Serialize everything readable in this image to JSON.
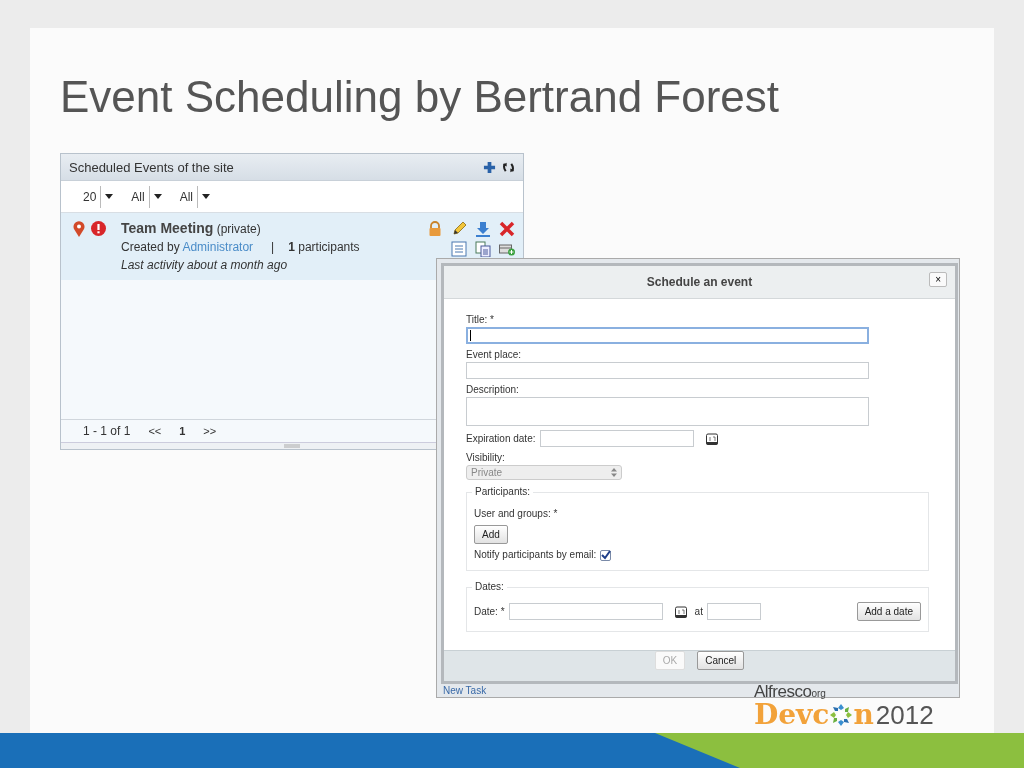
{
  "slide": {
    "title": "Event Scheduling by Bertrand Forest"
  },
  "events_panel": {
    "title": "Scheduled Events of the site",
    "filters": [
      {
        "value": "20"
      },
      {
        "value": "All"
      },
      {
        "value": "All"
      }
    ],
    "events": [
      {
        "title": "Team Meeting",
        "visibility": "(private)",
        "created_by_label": "Created by",
        "author": "Administrator",
        "separator": "|",
        "participants_count": "1",
        "participants_label": "participants",
        "activity": "Last activity about a month ago",
        "selected": true
      }
    ],
    "pager": {
      "range": "1 - 1 of 1",
      "first": "<<",
      "page": "1",
      "next": ">>"
    }
  },
  "background_window": {
    "link": "New Task"
  },
  "dialog": {
    "title": "Schedule an event",
    "close": "×",
    "title_label": "Title: *",
    "title_focused": true,
    "place_label": "Event place:",
    "description_label": "Description:",
    "expiration_label": "Expiration date:",
    "visibility_label": "Visibility:",
    "visibility_value": "Private",
    "participants_legend": "Participants:",
    "users_label": "User and groups: *",
    "add_button": "Add",
    "notify_label": "Notify participants by email:",
    "notify_checked": true,
    "dates_legend": "Dates:",
    "date_label": "Date: *",
    "at_label": "at",
    "add_date_button": "Add a date",
    "ok_button": {
      "label": "OK",
      "disabled": true
    },
    "cancel_button": {
      "label": "Cancel",
      "disabled": false
    }
  },
  "logo": {
    "brand": "Alfresco",
    "suffix": "org",
    "word_start": "Devc",
    "word_end": "n",
    "year": "2012"
  }
}
